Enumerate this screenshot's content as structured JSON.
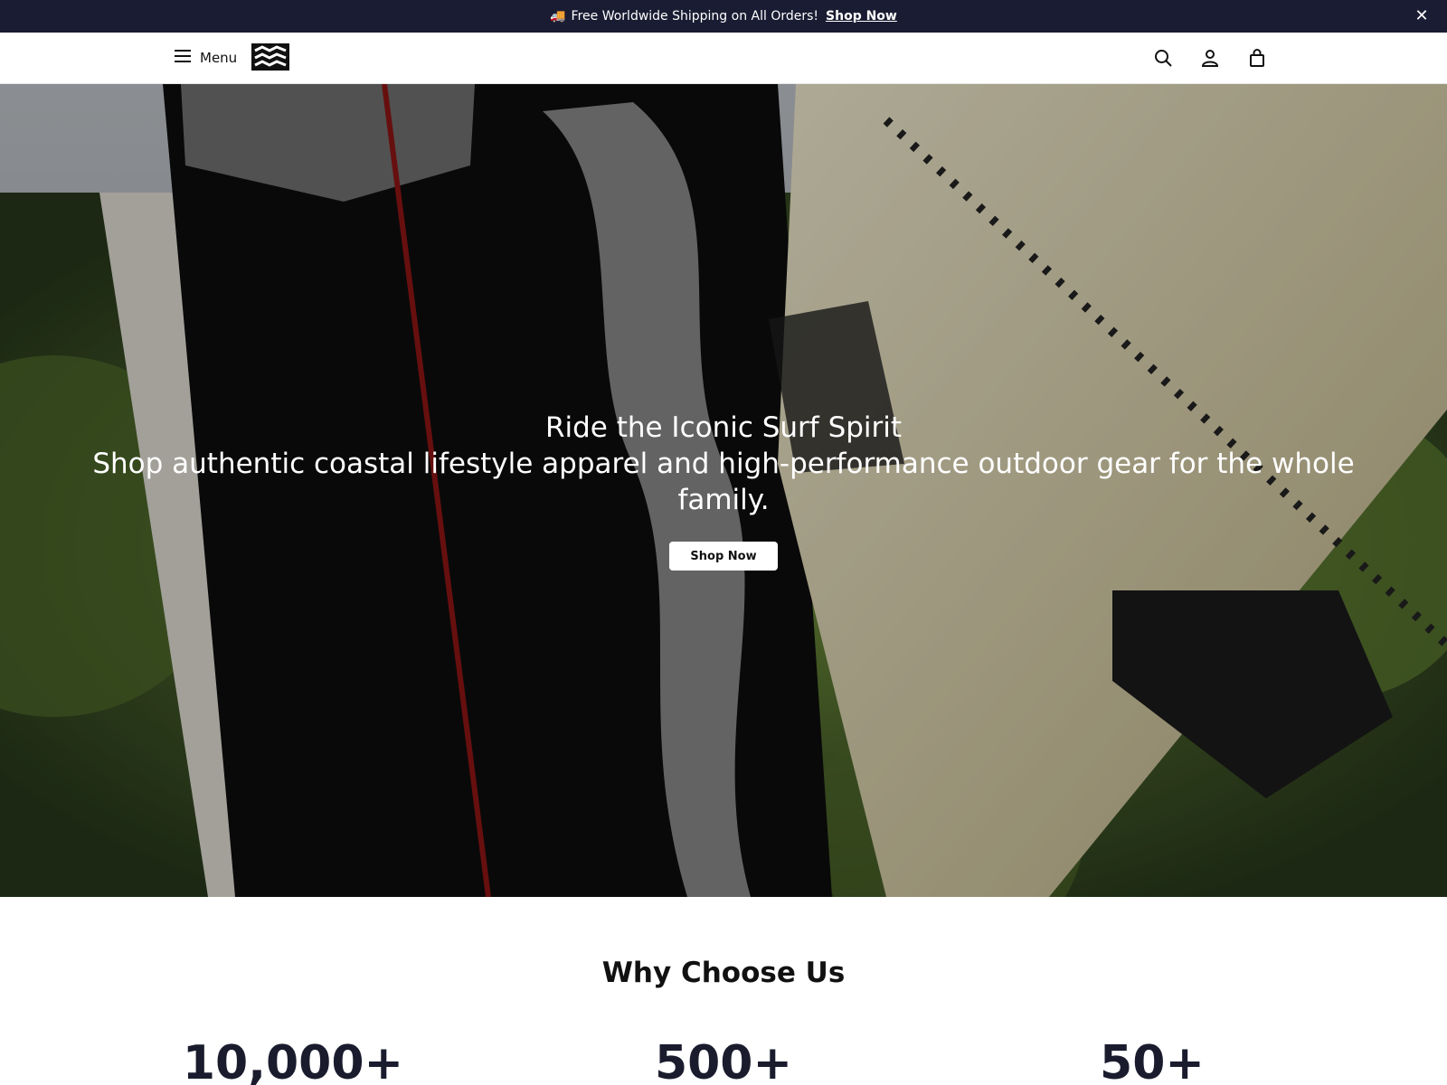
{
  "announcement": {
    "icon": "truck-icon",
    "text": "Free Worldwide Shipping on All Orders!",
    "link_label": "Shop Now",
    "close_icon": "close-icon"
  },
  "header": {
    "menu_label": "Menu",
    "icons": [
      "search-icon",
      "account-icon",
      "cart-icon"
    ]
  },
  "hero": {
    "title": "Ride the Iconic Surf Spirit",
    "subtitle": "Shop authentic coastal lifestyle apparel and high-performance outdoor gear for the whole family.",
    "cta_label": "Shop Now"
  },
  "why": {
    "title": "Why Choose Us",
    "stats": [
      {
        "value": "10,000+"
      },
      {
        "value": "500+"
      },
      {
        "value": "50+"
      }
    ]
  },
  "colors": {
    "announce_bg": "#1a1c33",
    "text_dark": "#111111"
  }
}
